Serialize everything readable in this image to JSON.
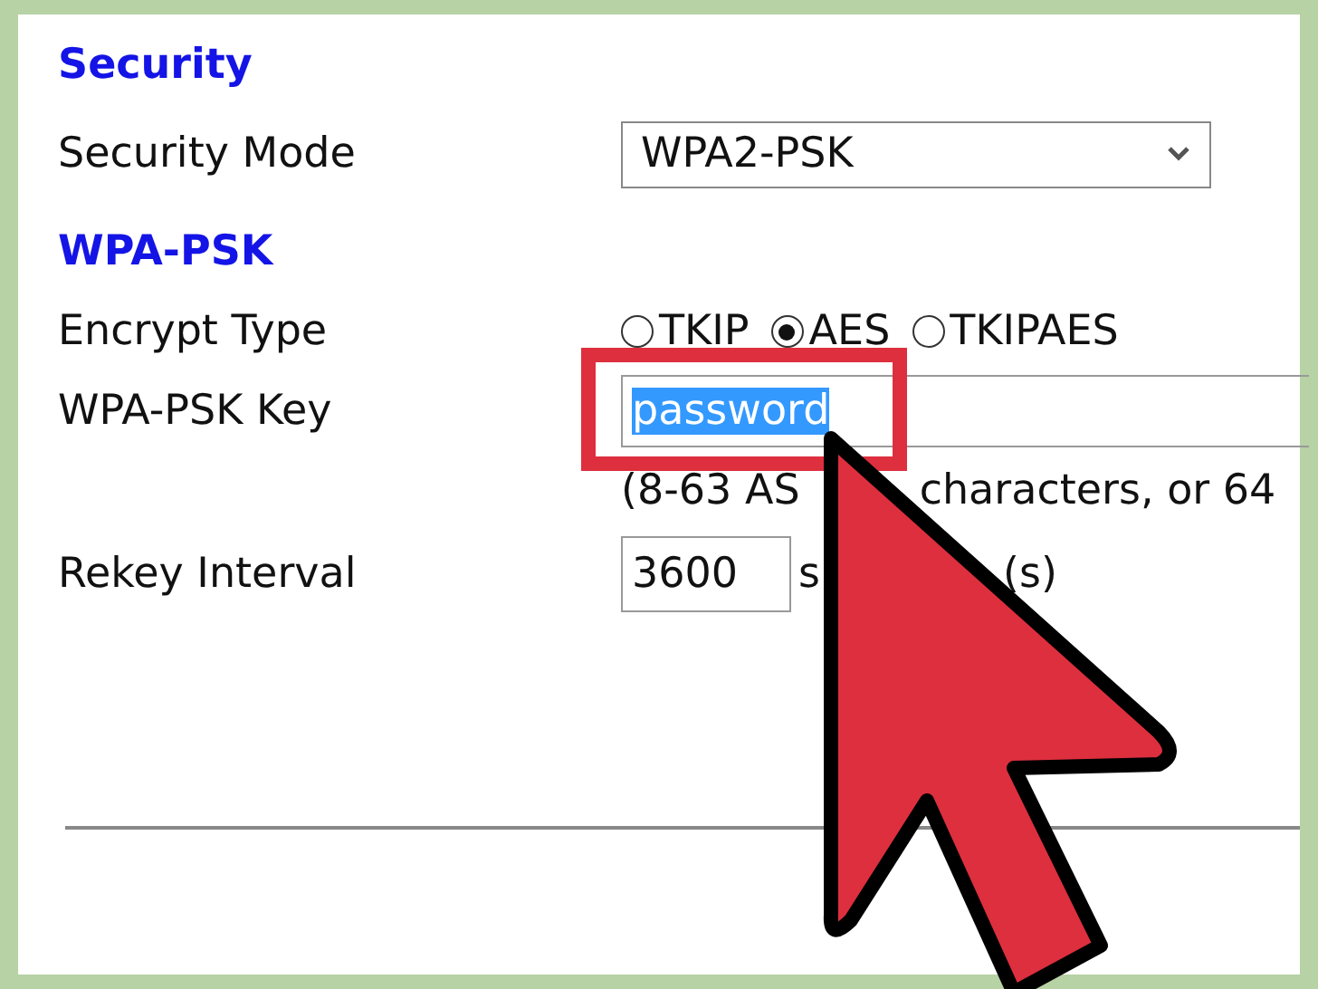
{
  "sections": [
    {
      "heading": "Security",
      "rows": [
        {
          "kind": "select",
          "label": "Security Mode",
          "value": "WPA2-PSK"
        }
      ]
    },
    {
      "heading": "WPA-PSK",
      "rows": [
        {
          "kind": "radios",
          "label": "Encrypt Type",
          "options": [
            {
              "label": "TKIP",
              "selected": false
            },
            {
              "label": "AES",
              "selected": true
            },
            {
              "label": "TKIPAES",
              "selected": false
            }
          ]
        },
        {
          "kind": "text",
          "label": "WPA-PSK Key",
          "value": "password",
          "text_selected": true,
          "highlighted": true,
          "hint_parts": [
            "(8-63 AS",
            "characters, or 64"
          ]
        },
        {
          "kind": "number",
          "label": "Rekey Interval",
          "value": "3600",
          "unit_parts": [
            "s",
            "(s)"
          ]
        }
      ]
    }
  ]
}
